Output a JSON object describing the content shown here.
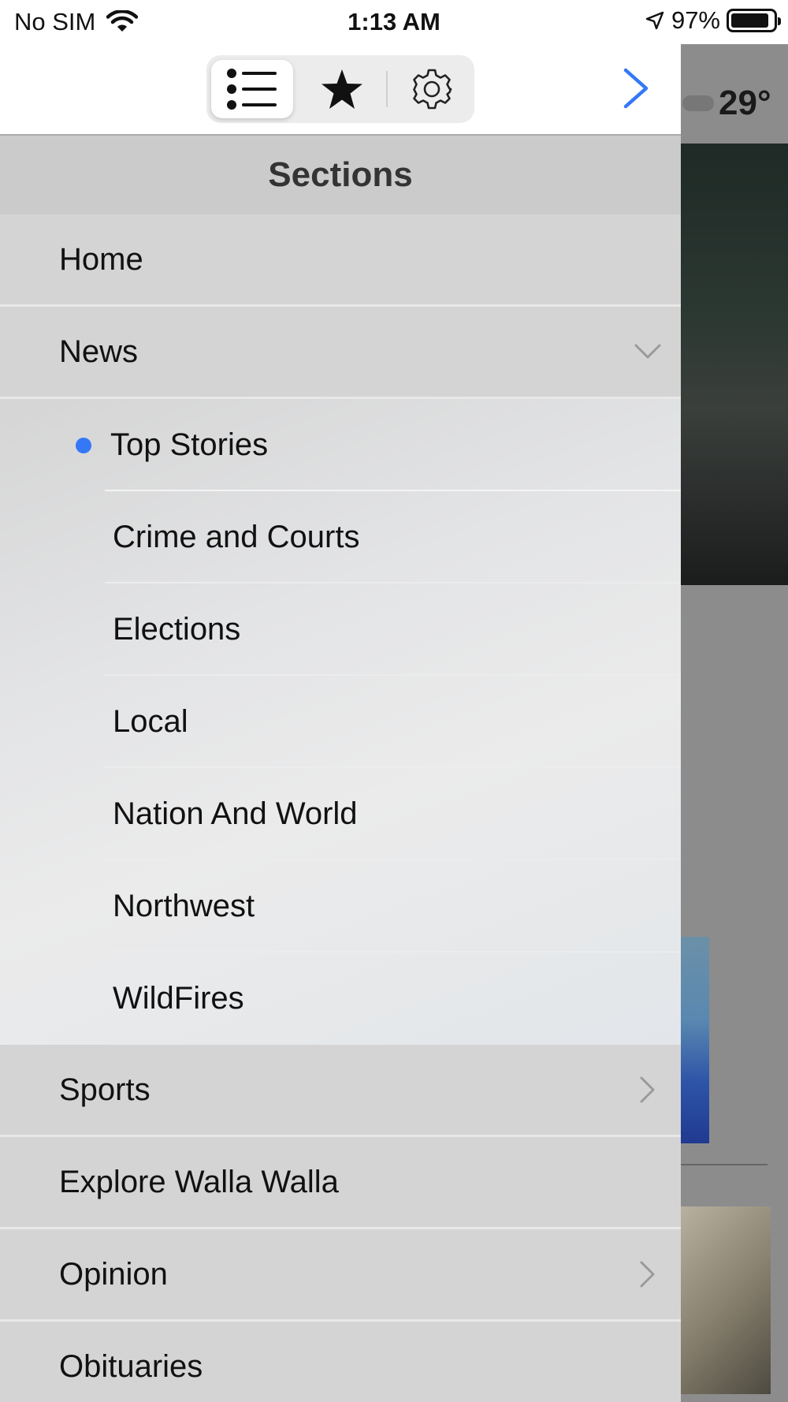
{
  "status_bar": {
    "carrier": "No SIM",
    "time": "1:13 AM",
    "battery": "97%",
    "battery_level": 0.97
  },
  "toolbar": {
    "segments": [
      {
        "icon": "list-icon",
        "selected": true
      },
      {
        "icon": "star-icon",
        "selected": false
      },
      {
        "icon": "gear-icon",
        "selected": false
      }
    ],
    "next_icon": "chevron-right-icon"
  },
  "background": {
    "temperature": "29°"
  },
  "sections": {
    "title": "Sections",
    "items": [
      {
        "label": "Home"
      },
      {
        "label": "News",
        "expanded": true
      },
      {
        "label": "Top Stories",
        "selected": true
      },
      {
        "label": "Crime and Courts"
      },
      {
        "label": "Elections"
      },
      {
        "label": "Local"
      },
      {
        "label": "Nation And World"
      },
      {
        "label": "Northwest"
      },
      {
        "label": "WildFires"
      },
      {
        "label": "Sports",
        "has_children": true
      },
      {
        "label": "Explore Walla Walla"
      },
      {
        "label": "Opinion",
        "has_children": true
      },
      {
        "label": "Obituaries"
      }
    ]
  },
  "colors": {
    "accent": "#3478f6",
    "drawer_bg": "#d4d4d4",
    "header_bg": "#cbcbcb"
  }
}
